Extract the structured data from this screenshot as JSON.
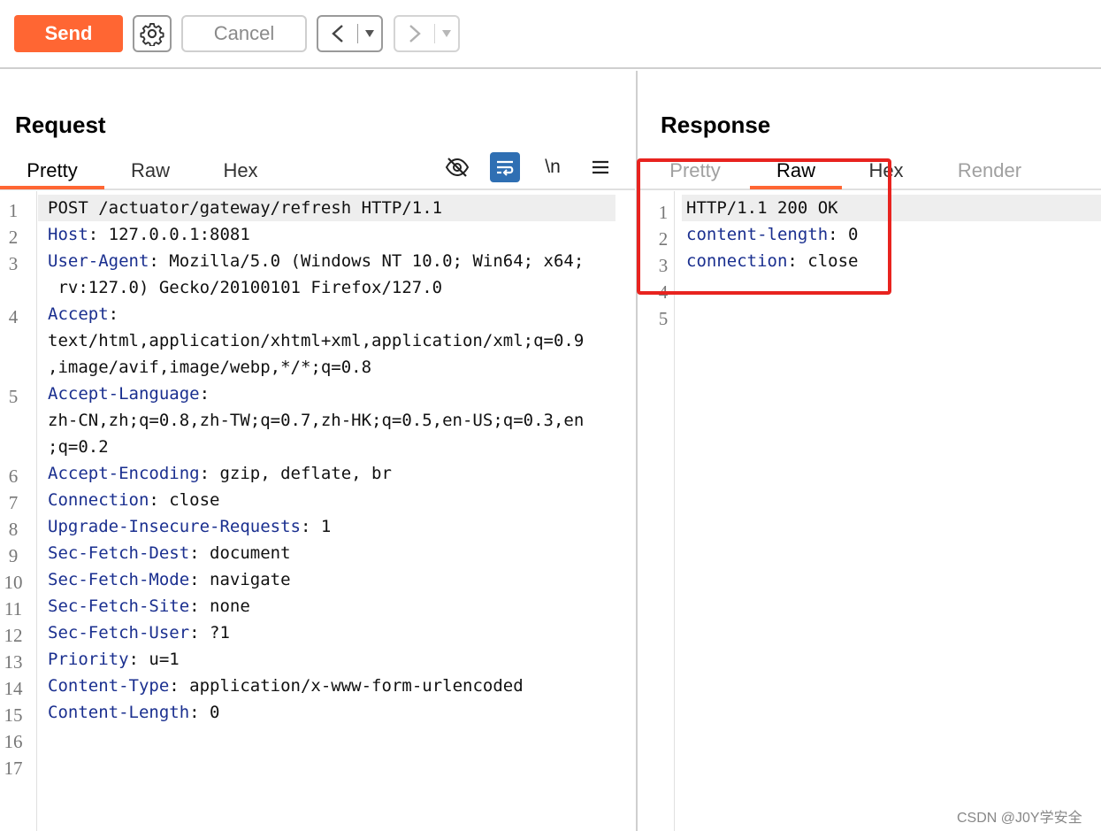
{
  "toolbar": {
    "send_label": "Send",
    "cancel_label": "Cancel",
    "back_label": "<",
    "forward_label": ">",
    "dropdown_glyph": "▾",
    "icons": {
      "settings": "gear-icon"
    }
  },
  "request": {
    "title": "Request",
    "tabs": [
      {
        "label": "Pretty"
      },
      {
        "label": "Raw"
      },
      {
        "label": "Hex"
      }
    ],
    "tools": {
      "hide": "eye-slash-icon",
      "wrap": "wrap-lines-icon",
      "newline": "\\n",
      "menu": "menu-icon"
    },
    "line_numbers": [
      "1",
      "2",
      "3",
      "4",
      "5",
      "6",
      "7",
      "8",
      "9",
      "10",
      "11",
      "12",
      "13",
      "14",
      "15",
      "16",
      "17"
    ],
    "lines": [
      {
        "key": "",
        "val": "POST /actuator/gateway/refresh HTTP/1.1"
      },
      {
        "key": "Host",
        "val": ": 127.0.0.1:8081"
      },
      {
        "key": "User-Agent",
        "val": ": Mozilla/5.0 (Windows NT 10.0; Win64; x64;"
      },
      {
        "key": "",
        "val": " rv:127.0) Gecko/20100101 Firefox/127.0"
      },
      {
        "key": "Accept",
        "val": ":"
      },
      {
        "key": "",
        "val": "text/html,application/xhtml+xml,application/xml;q=0.9"
      },
      {
        "key": "",
        "val": ",image/avif,image/webp,*/*;q=0.8"
      },
      {
        "key": "Accept-Language",
        "val": ":"
      },
      {
        "key": "",
        "val": "zh-CN,zh;q=0.8,zh-TW;q=0.7,zh-HK;q=0.5,en-US;q=0.3,en"
      },
      {
        "key": "",
        "val": ";q=0.2"
      },
      {
        "key": "Accept-Encoding",
        "val": ": gzip, deflate, br"
      },
      {
        "key": "Connection",
        "val": ": close"
      },
      {
        "key": "Upgrade-Insecure-Requests",
        "val": ": 1"
      },
      {
        "key": "Sec-Fetch-Dest",
        "val": ": document"
      },
      {
        "key": "Sec-Fetch-Mode",
        "val": ": navigate"
      },
      {
        "key": "Sec-Fetch-Site",
        "val": ": none"
      },
      {
        "key": "Sec-Fetch-User",
        "val": ": ?1"
      },
      {
        "key": "Priority",
        "val": ": u=1"
      },
      {
        "key": "Content-Type",
        "val": ": application/x-www-form-urlencoded"
      },
      {
        "key": "Content-Length",
        "val": ": 0"
      }
    ]
  },
  "response": {
    "title": "Response",
    "tabs": [
      {
        "label": "Pretty"
      },
      {
        "label": "Raw"
      },
      {
        "label": "Hex"
      },
      {
        "label": "Render"
      }
    ],
    "line_numbers": [
      "1",
      "2",
      "3",
      "4",
      "5"
    ],
    "lines": [
      {
        "key": "",
        "val": "HTTP/1.1 200 OK"
      },
      {
        "key": "content-length",
        "val": ": 0"
      },
      {
        "key": "connection",
        "val": ": close"
      }
    ]
  },
  "watermark": "CSDN @J0Y学安全",
  "colors": {
    "accent": "#ff6633",
    "key": "#1a2f8f",
    "highlight_box": "#e8231f",
    "wrap_active": "#2f6fb3"
  }
}
